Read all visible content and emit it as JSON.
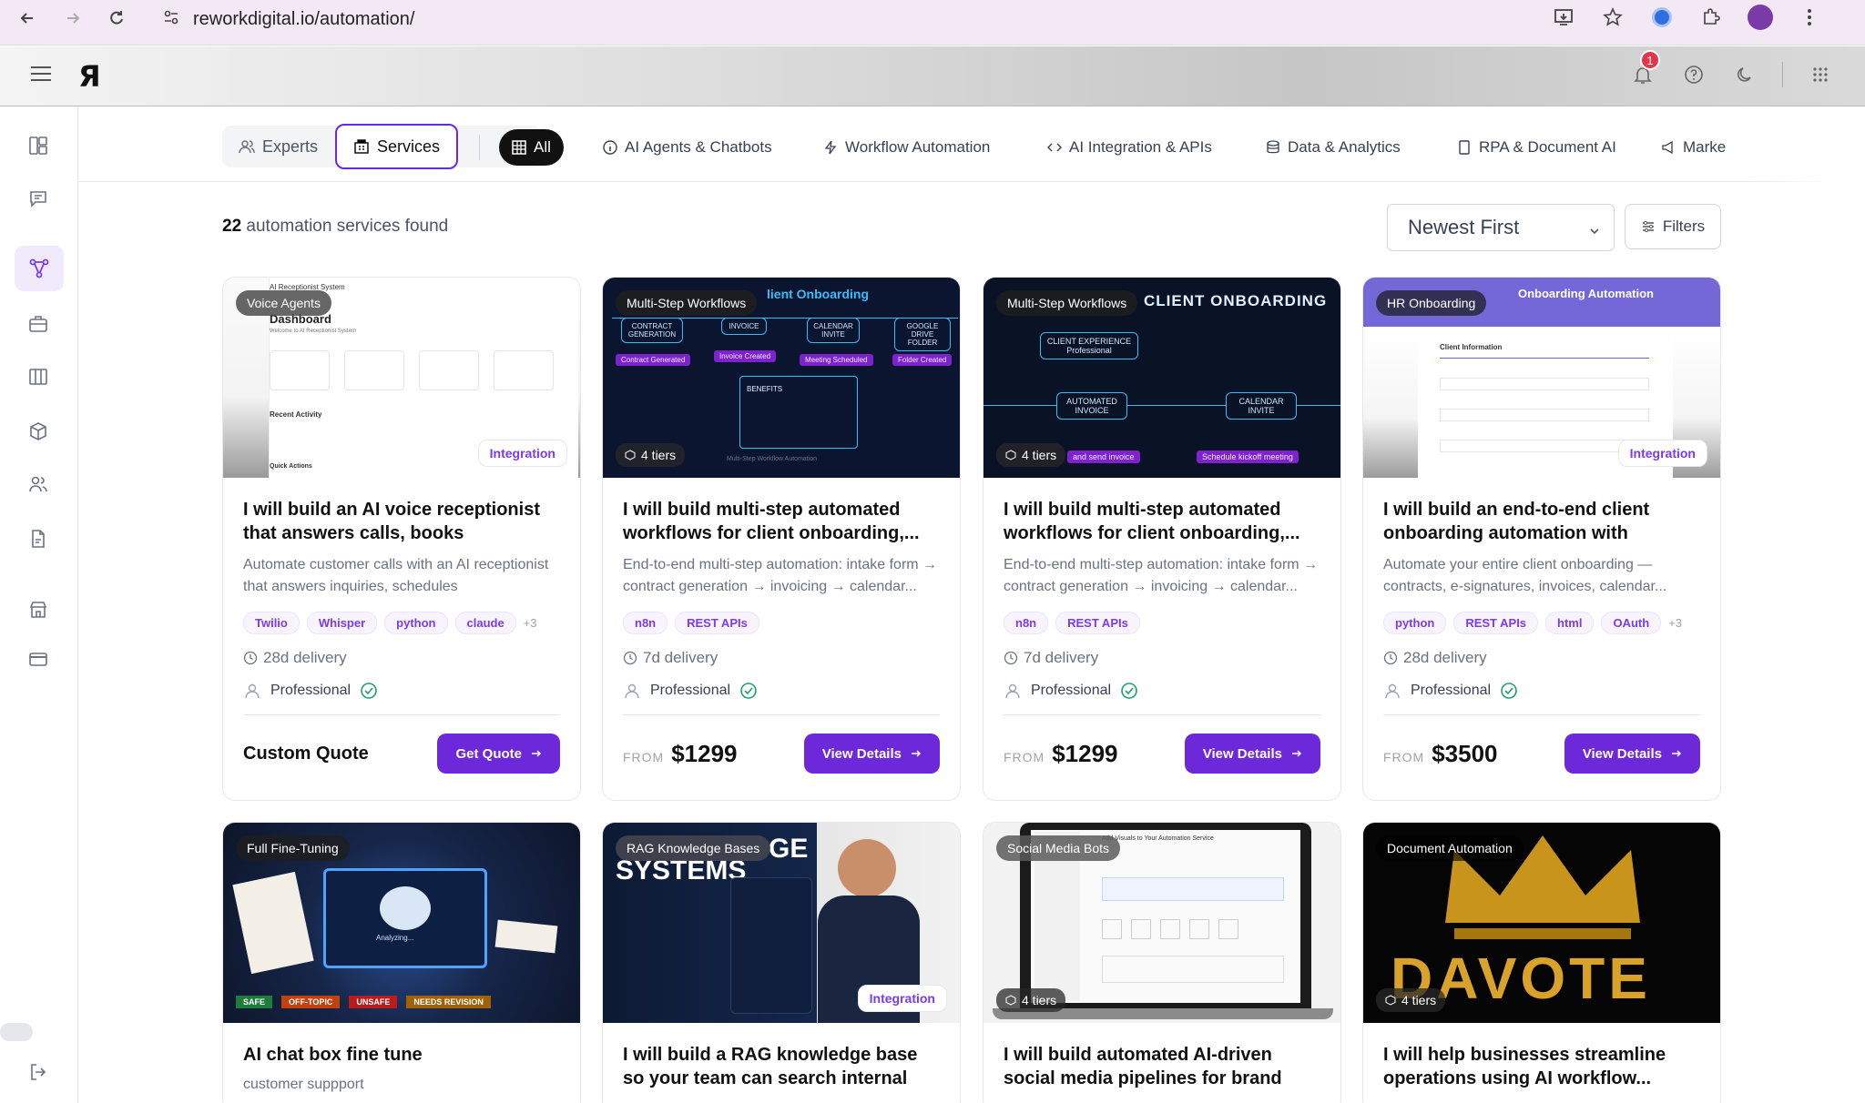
{
  "browser": {
    "url": "reworkdigital.io/automation/"
  },
  "header": {
    "logo": "Я",
    "notification_count": "1"
  },
  "toggle": {
    "experts_label": "Experts",
    "services_label": "Services"
  },
  "categories": [
    {
      "label": "All",
      "icon": "grid-icon"
    },
    {
      "label": "AI Agents & Chatbots",
      "icon": "info-icon"
    },
    {
      "label": "Workflow Automation",
      "icon": "lightning-icon"
    },
    {
      "label": "AI Integration & APIs",
      "icon": "code-icon"
    },
    {
      "label": "Data & Analytics",
      "icon": "database-icon"
    },
    {
      "label": "RPA & Document AI",
      "icon": "document-icon"
    },
    {
      "label": "Marke",
      "icon": "megaphone-icon"
    }
  ],
  "results": {
    "count": "22",
    "label": "automation services found"
  },
  "sort": {
    "selected": "Newest First"
  },
  "filters_label": "Filters",
  "cards": [
    {
      "category": "Voice Agents",
      "badge": "Integration",
      "title": "I will build an AI voice receptionist that answers calls, books appointments, a...",
      "desc": "Automate customer calls with an AI receptionist that answers inquiries, schedules appointments...",
      "tags": [
        "Twilio",
        "Whisper",
        "python",
        "claude"
      ],
      "more": "+3",
      "delivery": "28d delivery",
      "level": "Professional",
      "price_label": "Custom Quote",
      "cta": "Get Quote",
      "thumb_texts": {
        "title": "AI Receptionist System",
        "heading": "Dashboard",
        "sub": "Welcome to AI Receptionist System",
        "section": "Recent Activity",
        "section2": "Quick Actions"
      }
    },
    {
      "category": "Multi-Step Workflows",
      "tiers": "4 tiers",
      "title": "I will build multi-step automated workflows for client onboarding,...",
      "desc": "End-to-end multi-step automation: intake form → contract generation → invoicing → calendar...",
      "tags": [
        "n8n",
        "REST APIs"
      ],
      "delivery": "7d delivery",
      "level": "Professional",
      "from": "FROM",
      "price": "$1299",
      "cta": "View Details",
      "thumb_texts": {
        "title": "lient Onboarding",
        "b1": "CONTRACT GENERATION",
        "b2": "INVOICE",
        "b3": "CALENDAR INVITE",
        "b4": "GOOGLE DRIVE FOLDER",
        "p1": "Contract Generated",
        "p2": "Invoice Created",
        "p3": "Meeting Scheduled",
        "p4": "Folder Created",
        "benefits": "BENEFITS",
        "footer": "Multi-Step Workflow Automation"
      }
    },
    {
      "category": "Multi-Step Workflows",
      "tiers": "4 tiers",
      "title": "I will build multi-step automated workflows for client onboarding,...",
      "desc": "End-to-end multi-step automation: intake form → contract generation → invoicing → calendar...",
      "tags": [
        "n8n",
        "REST APIs"
      ],
      "delivery": "7d delivery",
      "level": "Professional",
      "from": "FROM",
      "price": "$1299",
      "cta": "View Details",
      "thumb_texts": {
        "title": "CLIENT ONBOARDING",
        "b1": "CLIENT EXPERIENCE Professional",
        "b2": "AUTOMATED INVOICE",
        "b3": "CALENDAR INVITE",
        "p1": "and send invoice",
        "p2": "Schedule kickoff meeting"
      }
    },
    {
      "category": "HR Onboarding",
      "badge": "Integration",
      "title": "I will build an end-to-end client onboarding automation with contract...",
      "desc": "Automate your entire client onboarding — contracts, e-signatures, invoices, calendar...",
      "tags": [
        "python",
        "REST APIs",
        "html",
        "OAuth"
      ],
      "more": "+3",
      "delivery": "28d delivery",
      "level": "Professional",
      "from": "FROM",
      "price": "$3500",
      "cta": "View Details",
      "thumb_texts": {
        "title": "Onboarding Automation",
        "section": "Client Information"
      }
    },
    {
      "category": "Full Fine-Tuning",
      "title": "AI chat box fine tune",
      "desc": "customer suppport",
      "thumb_texts": {
        "l1": "SAFE",
        "l2": "OFF-TOPIC",
        "l3": "UNSAFE",
        "l4": "NEEDS REVISION",
        "center": "Analyzing..."
      }
    },
    {
      "category": "RAG Knowledge Bases",
      "badge": "Integration",
      "title": "I will build a RAG knowledge base so your team can search internal docs in...",
      "desc": "",
      "thumb_texts": {
        "big": "SYSTEMS",
        "big2": "GE"
      }
    },
    {
      "category": "Social Media Bots",
      "tiers": "4 tiers",
      "title": "I will build automated AI-driven social media pipelines for brand growth.",
      "desc": "",
      "thumb_texts": {
        "title": "Add Visuals to Your Automation Service"
      }
    },
    {
      "category": "Document Automation",
      "tiers": "4 tiers",
      "title": "I will help businesses streamline operations using AI workflow...",
      "desc": "",
      "thumb_texts": {
        "big": "DAVOTE"
      }
    }
  ]
}
